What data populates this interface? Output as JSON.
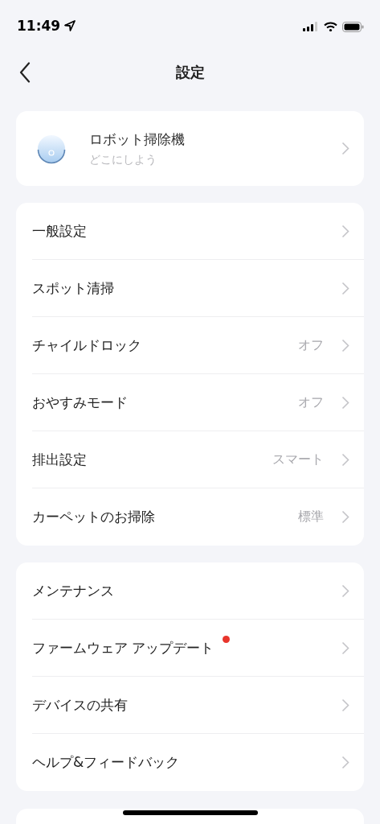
{
  "status_bar": {
    "time": "11:49"
  },
  "nav": {
    "title": "設定"
  },
  "device": {
    "name": "ロボット掃除機",
    "subtitle": "どこにしよう"
  },
  "groups": [
    {
      "items": [
        {
          "label": "一般設定",
          "badge": false
        },
        {
          "label": "スポット清掃",
          "badge": false
        },
        {
          "label": "チャイルドロック",
          "value": "オフ",
          "badge": false
        },
        {
          "label": "おやすみモード",
          "value": "オフ",
          "badge": false
        },
        {
          "label": "排出設定",
          "value": "スマート",
          "badge": false
        },
        {
          "label": "カーペットのお掃除",
          "value": "標準",
          "badge": false
        }
      ]
    },
    {
      "items": [
        {
          "label": "メンテナンス",
          "badge": false
        },
        {
          "label": "ファームウェア アップデート",
          "badge": true
        },
        {
          "label": "デバイスの共有",
          "badge": false
        },
        {
          "label": "ヘルプ&フィードバック",
          "badge": false
        }
      ]
    }
  ]
}
